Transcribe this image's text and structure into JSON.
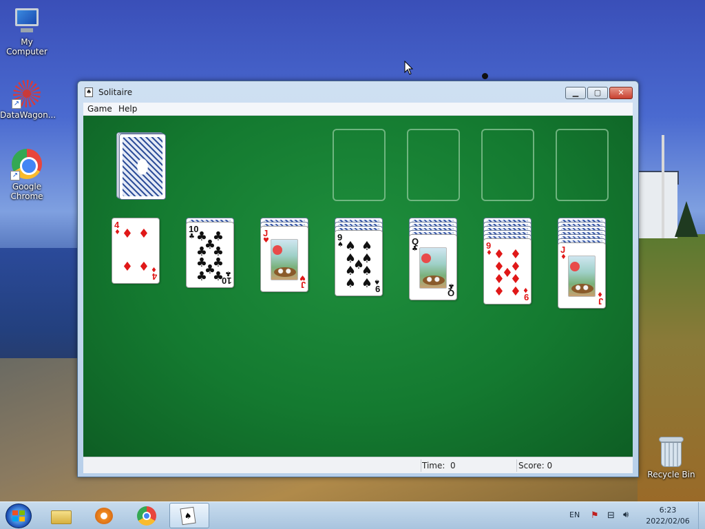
{
  "desktop": {
    "icons": [
      {
        "label": "My Computer"
      },
      {
        "label": "DataWagon..."
      },
      {
        "label": "Google Chrome"
      },
      {
        "label": "Recycle Bin"
      }
    ]
  },
  "window": {
    "title": "Solitaire",
    "menu": [
      "Game",
      "Help"
    ],
    "status": {
      "time_label": "Time:",
      "time_value": "0",
      "score_label": "Score: 0"
    }
  },
  "game": {
    "stock": "face-down deck",
    "foundations": 4,
    "tableau": [
      {
        "hidden": 0,
        "rank": "4",
        "suit": "♦",
        "color": "#e01818"
      },
      {
        "hidden": 1,
        "rank": "10",
        "suit": "♣",
        "color": "#111111"
      },
      {
        "hidden": 2,
        "rank": "J",
        "suit": "♥",
        "color": "#e01818"
      },
      {
        "hidden": 3,
        "rank": "9",
        "suit": "♠",
        "color": "#111111"
      },
      {
        "hidden": 4,
        "rank": "Q",
        "suit": "♣",
        "color": "#111111"
      },
      {
        "hidden": 5,
        "rank": "9",
        "suit": "♦",
        "color": "#e01818"
      },
      {
        "hidden": 6,
        "rank": "J",
        "suit": "♦",
        "color": "#e01818"
      }
    ]
  },
  "taskbar": {
    "language": "EN",
    "time": "6:23",
    "date": "2022/02/06"
  }
}
